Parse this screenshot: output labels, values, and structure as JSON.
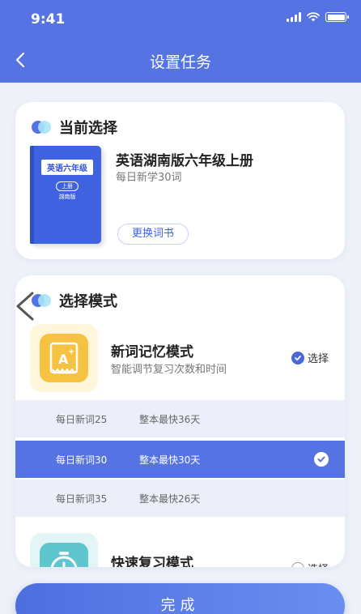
{
  "status_bar": {
    "time": "9:41"
  },
  "nav": {
    "title": "设置任务"
  },
  "current": {
    "section_title": "当前选择",
    "book": {
      "name": "英语湖南版六年级上册",
      "daily": "每日新学30词",
      "cover_title": "英语六年级",
      "cover_tag": "上册",
      "cover_edition": "湖南版"
    },
    "change_label": "更换词书"
  },
  "modes": {
    "section_title": "选择模式",
    "items": [
      {
        "name": "新词记忆模式",
        "desc": "智能调节复习次数和时间",
        "select_label": "选择",
        "selected": true,
        "icon": "a-plus-card-icon"
      },
      {
        "name": "快速复习模式",
        "select_label": "选择",
        "selected": false,
        "icon": "alarm-clock-icon"
      }
    ],
    "options": [
      {
        "daily": "每日新词25",
        "finish": "整本最快36天",
        "selected": false
      },
      {
        "daily": "每日新词30",
        "finish": "整本最快30天",
        "selected": true
      },
      {
        "daily": "每日新词35",
        "finish": "整本最快26天",
        "selected": false
      }
    ]
  },
  "done_label": "完成",
  "colors": {
    "primary": "#5573e3",
    "option_bg": "#eceff9",
    "accent_icon": "#f6c242",
    "teal_icon": "#5fc6cf"
  }
}
